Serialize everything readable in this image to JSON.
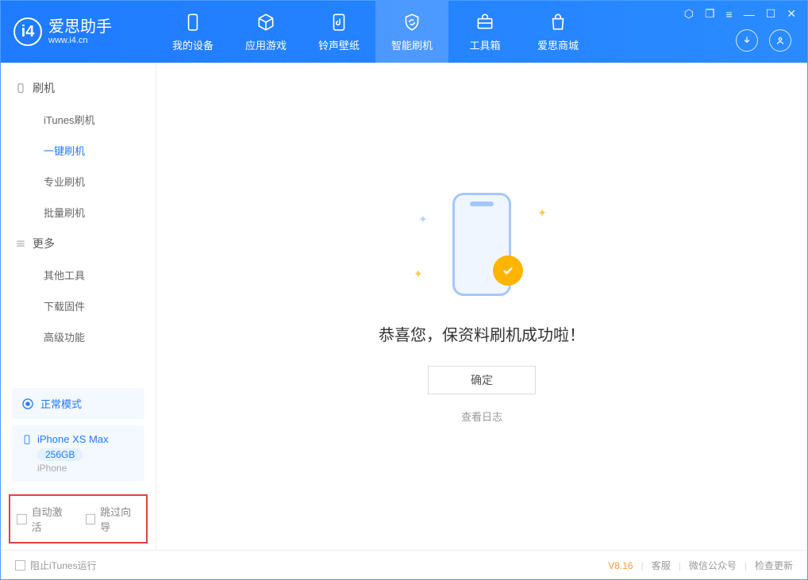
{
  "app": {
    "name": "爱思助手",
    "url": "www.i4.cn"
  },
  "nav": {
    "tabs": [
      {
        "label": "我的设备"
      },
      {
        "label": "应用游戏"
      },
      {
        "label": "铃声壁纸"
      },
      {
        "label": "智能刷机"
      },
      {
        "label": "工具箱"
      },
      {
        "label": "爱思商城"
      }
    ]
  },
  "sidebar": {
    "section_flash": "刷机",
    "items_flash": [
      {
        "label": "iTunes刷机"
      },
      {
        "label": "一键刷机"
      },
      {
        "label": "专业刷机"
      },
      {
        "label": "批量刷机"
      }
    ],
    "section_more": "更多",
    "items_more": [
      {
        "label": "其他工具"
      },
      {
        "label": "下载固件"
      },
      {
        "label": "高级功能"
      }
    ],
    "mode_label": "正常模式",
    "device": {
      "name": "iPhone XS Max",
      "storage": "256GB",
      "type": "iPhone"
    },
    "chk_auto_activate": "自动激活",
    "chk_skip_guide": "跳过向导"
  },
  "main": {
    "success_message": "恭喜您，保资料刷机成功啦！",
    "confirm_label": "确定",
    "view_log_label": "查看日志"
  },
  "footer": {
    "block_itunes": "阻止iTunes运行",
    "version": "V8.16",
    "support": "客服",
    "wechat": "微信公众号",
    "check_update": "检查更新"
  }
}
